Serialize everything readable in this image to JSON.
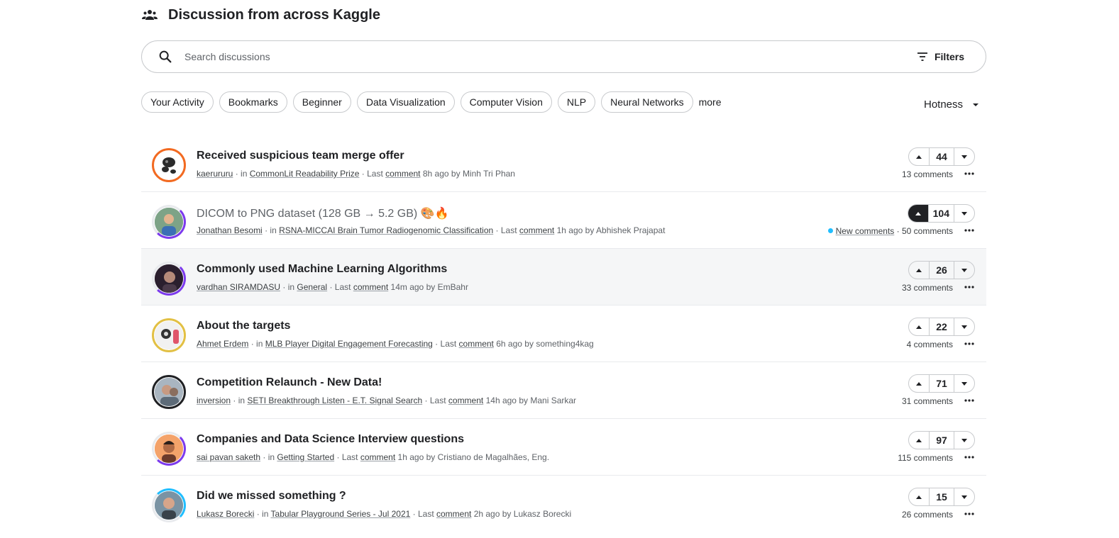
{
  "header": {
    "title": "Discussion from across Kaggle"
  },
  "search": {
    "placeholder": "Search discussions",
    "filters_label": "Filters"
  },
  "chips": [
    "Your Activity",
    "Bookmarks",
    "Beginner",
    "Data Visualization",
    "Computer Vision",
    "NLP",
    "Neural Networks"
  ],
  "chips_more": "more",
  "sort": {
    "label": "Hotness"
  },
  "meta_labels": {
    "in": "in",
    "last": "Last",
    "comment": "comment",
    "by": "by",
    "new_comments": "New comments"
  },
  "topics": [
    {
      "title": "Received suspicious team merge offer",
      "author": "kaerururu",
      "forum": "CommonLit Readability Prize",
      "ago": "8h ago",
      "last_by": "Minh Tri Phan",
      "votes": "44",
      "comments": "13 comments",
      "ring_color": "#f26a21"
    },
    {
      "title": "DICOM to PNG dataset (128 GB → 5.2 GB) 🎨🔥",
      "author": "Jonathan Besomi",
      "forum": "RSNA-MICCAI Brain Tumor Radiogenomic Classification",
      "ago": "1h ago",
      "last_by": "Abhishek Prajapat",
      "votes": "104",
      "comments": "50 comments",
      "ring_color": "#7c3aed"
    },
    {
      "title": "Commonly used Machine Learning Algorithms",
      "author": "vardhan SIRAMDASU",
      "forum": "General",
      "ago": "14m ago",
      "last_by": "EmBahr",
      "votes": "26",
      "comments": "33 comments",
      "ring_color": "#7c3aed"
    },
    {
      "title": "About the targets",
      "author": "Ahmet Erdem",
      "forum": "MLB Player Digital Engagement Forecasting",
      "ago": "6h ago",
      "last_by": "something4kag",
      "votes": "22",
      "comments": "4 comments",
      "ring_color": "#e2c044"
    },
    {
      "title": "Competition Relaunch - New Data!",
      "author": "inversion",
      "forum": "SETI Breakthrough Listen - E.T. Signal Search",
      "ago": "14h ago",
      "last_by": "Mani Sarkar",
      "votes": "71",
      "comments": "31 comments",
      "ring_color": "#202124"
    },
    {
      "title": "Companies and Data Science Interview questions",
      "author": "sai pavan saketh",
      "forum": "Getting Started",
      "ago": "1h ago",
      "last_by": "Cristiano de Magalhães, Eng.",
      "votes": "97",
      "comments": "115 comments",
      "ring_color": "#7c3aed"
    },
    {
      "title": "Did we missed something ?",
      "author": "Lukasz Borecki",
      "forum": "Tabular Playground Series - Jul 2021",
      "ago": "2h ago",
      "last_by": "Lukasz Borecki",
      "votes": "15",
      "comments": "26 comments",
      "ring_color": "#20beff"
    }
  ]
}
